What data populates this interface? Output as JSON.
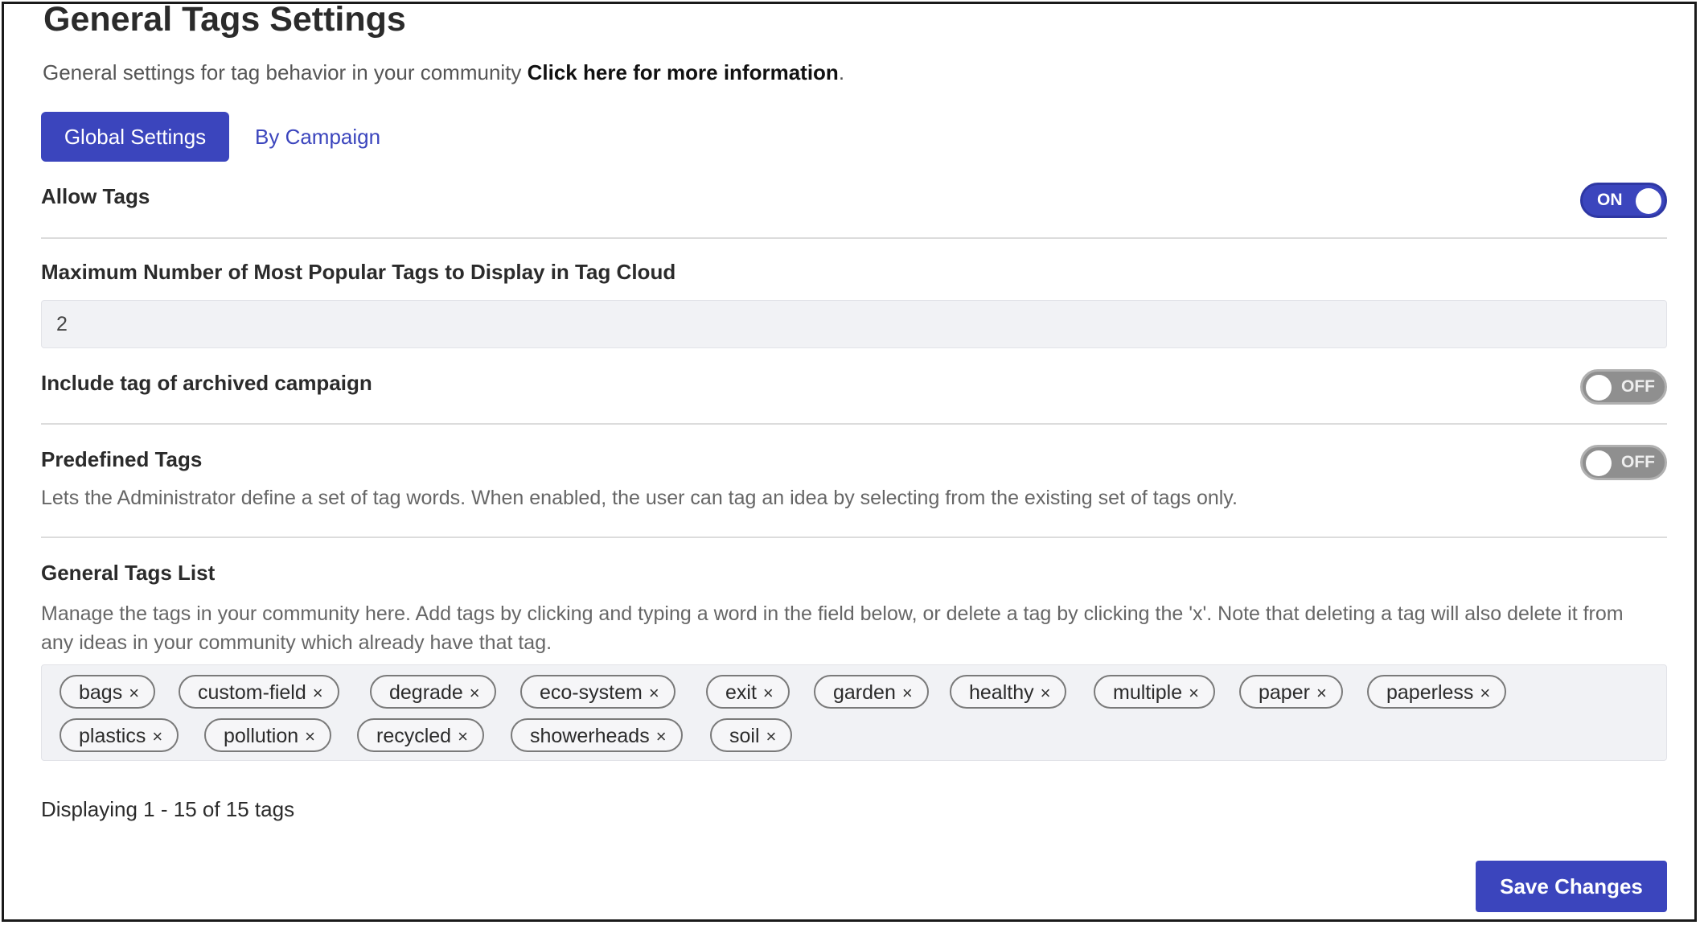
{
  "header": {
    "title": "General Tags Settings",
    "subtitle_text": "General settings for tag behavior in your community ",
    "info_link": "Click here for more information",
    "subtitle_end": "."
  },
  "tabs": [
    {
      "label": "Global Settings",
      "active": true
    },
    {
      "label": "By Campaign",
      "active": false
    }
  ],
  "settings": {
    "allow_tags": {
      "label": "Allow Tags",
      "state": "ON"
    },
    "max_popular": {
      "label": "Maximum Number of Most Popular Tags to Display in Tag Cloud",
      "value": "2"
    },
    "include_archived": {
      "label": "Include tag of archived campaign",
      "state": "OFF"
    },
    "predefined": {
      "label": "Predefined Tags",
      "state": "OFF",
      "description": "Lets the Administrator define a set of tag words. When enabled, the user can tag an idea by selecting from the existing set of tags only."
    }
  },
  "tags_list": {
    "label": "General Tags List",
    "description": "Manage the tags in your community here. Add tags by clicking and typing a word in the field below, or delete a tag by clicking the 'x'. Note that deleting a tag will also delete it from any ideas in your community which already have that tag.",
    "remove_symbol": "×",
    "tags": [
      "bags",
      "custom-field",
      "degrade",
      "eco-system",
      "exit",
      "garden",
      "healthy",
      "multiple",
      "paper",
      "paperless",
      "plastics",
      "pollution",
      "recycled",
      "showerheads",
      "soil"
    ]
  },
  "footer": {
    "count_text": "Displaying 1 - 15 of 15 tags",
    "save_label": "Save Changes"
  },
  "colors": {
    "accent": "#3b45bd",
    "toggle_off": "#8f8f8f",
    "field_bg": "#f1f2f5"
  }
}
